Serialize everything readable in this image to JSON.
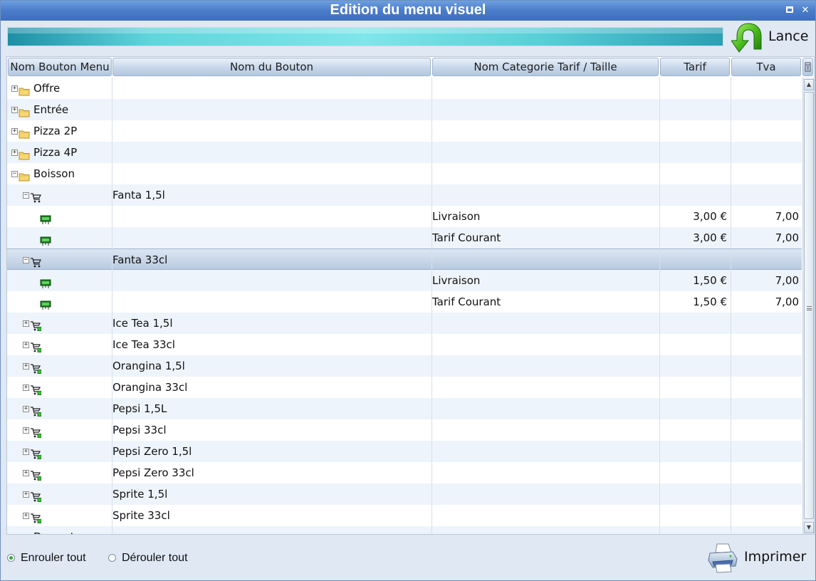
{
  "window": {
    "title": "Edition du menu visuel",
    "maximize_icon": "maximize-icon",
    "close_icon": "close-icon"
  },
  "toolbar": {
    "lance_label": "Lance",
    "lance_icon": "green-curved-arrow-icon"
  },
  "grid": {
    "columns": [
      "Nom Bouton Menu",
      "Nom du Bouton",
      "Nom Categorie Tarif / Taille",
      "Tarif",
      "Tva"
    ],
    "rows": [
      {
        "level": 0,
        "expander": "+",
        "icon": "folder-icon",
        "name": "Offre",
        "button": "",
        "category": "",
        "tarif": "",
        "tva": ""
      },
      {
        "level": 0,
        "expander": "+",
        "icon": "folder-icon",
        "name": "Entrée",
        "button": "",
        "category": "",
        "tarif": "",
        "tva": ""
      },
      {
        "level": 0,
        "expander": "+",
        "icon": "folder-icon",
        "name": "Pizza 2P",
        "button": "",
        "category": "",
        "tarif": "",
        "tva": ""
      },
      {
        "level": 0,
        "expander": "+",
        "icon": "folder-icon",
        "name": "Pizza 4P",
        "button": "",
        "category": "",
        "tarif": "",
        "tva": ""
      },
      {
        "level": 0,
        "expander": "−",
        "icon": "folder-icon",
        "name": "Boisson",
        "button": "",
        "category": "",
        "tarif": "",
        "tva": ""
      },
      {
        "level": 1,
        "expander": "−",
        "icon": "cart-icon",
        "name": "",
        "button": "Fanta 1,5l",
        "category": "",
        "tarif": "",
        "tva": ""
      },
      {
        "level": 2,
        "expander": "",
        "icon": "price-tag-icon",
        "name": "",
        "button": "",
        "category": "Livraison",
        "tarif": "3,00 €",
        "tva": "7,00"
      },
      {
        "level": 2,
        "expander": "",
        "icon": "price-tag-icon",
        "name": "",
        "button": "",
        "category": "Tarif Courant",
        "tarif": "3,00 €",
        "tva": "7,00"
      },
      {
        "level": 1,
        "expander": "−",
        "icon": "cart-icon",
        "name": "",
        "button": "Fanta 33cl",
        "category": "",
        "tarif": "",
        "tva": "",
        "selected": true
      },
      {
        "level": 2,
        "expander": "",
        "icon": "price-tag-icon",
        "name": "",
        "button": "",
        "category": "Livraison",
        "tarif": "1,50 €",
        "tva": "7,00"
      },
      {
        "level": 2,
        "expander": "",
        "icon": "price-tag-icon",
        "name": "",
        "button": "",
        "category": "Tarif Courant",
        "tarif": "1,50 €",
        "tva": "7,00"
      },
      {
        "level": 1,
        "expander": "+",
        "icon": "cart-add-icon",
        "name": "",
        "button": "Ice Tea 1,5l",
        "category": "",
        "tarif": "",
        "tva": ""
      },
      {
        "level": 1,
        "expander": "+",
        "icon": "cart-add-icon",
        "name": "",
        "button": "Ice Tea 33cl",
        "category": "",
        "tarif": "",
        "tva": ""
      },
      {
        "level": 1,
        "expander": "+",
        "icon": "cart-add-icon",
        "name": "",
        "button": "Orangina 1,5l",
        "category": "",
        "tarif": "",
        "tva": ""
      },
      {
        "level": 1,
        "expander": "+",
        "icon": "cart-add-icon",
        "name": "",
        "button": "Orangina 33cl",
        "category": "",
        "tarif": "",
        "tva": ""
      },
      {
        "level": 1,
        "expander": "+",
        "icon": "cart-add-icon",
        "name": "",
        "button": "Pepsi 1,5L",
        "category": "",
        "tarif": "",
        "tva": ""
      },
      {
        "level": 1,
        "expander": "+",
        "icon": "cart-add-icon",
        "name": "",
        "button": "Pepsi 33cl",
        "category": "",
        "tarif": "",
        "tva": ""
      },
      {
        "level": 1,
        "expander": "+",
        "icon": "cart-add-icon",
        "name": "",
        "button": "Pepsi Zero 1,5l",
        "category": "",
        "tarif": "",
        "tva": ""
      },
      {
        "level": 1,
        "expander": "+",
        "icon": "cart-add-icon",
        "name": "",
        "button": "Pepsi Zero 33cl",
        "category": "",
        "tarif": "",
        "tva": ""
      },
      {
        "level": 1,
        "expander": "+",
        "icon": "cart-add-icon",
        "name": "",
        "button": "Sprite 1,5l",
        "category": "",
        "tarif": "",
        "tva": ""
      },
      {
        "level": 1,
        "expander": "+",
        "icon": "cart-add-icon",
        "name": "",
        "button": "Sprite 33cl",
        "category": "",
        "tarif": "",
        "tva": ""
      },
      {
        "level": 0,
        "expander": "+",
        "icon": "folder-icon",
        "name": "Dessert",
        "button": "",
        "category": "",
        "tarif": "",
        "tva": ""
      }
    ]
  },
  "footer": {
    "collapse_all_label": "Enrouler tout",
    "collapse_all_selected": true,
    "expand_all_label": "Dérouler tout",
    "expand_all_selected": false,
    "print_label": "Imprimer",
    "print_icon": "printer-icon"
  },
  "colors": {
    "titlebar": "#4a7cc9",
    "progress": "#5fd6dc",
    "selected_row": "#c4d4e7",
    "radio_on": "#2faa2f"
  }
}
